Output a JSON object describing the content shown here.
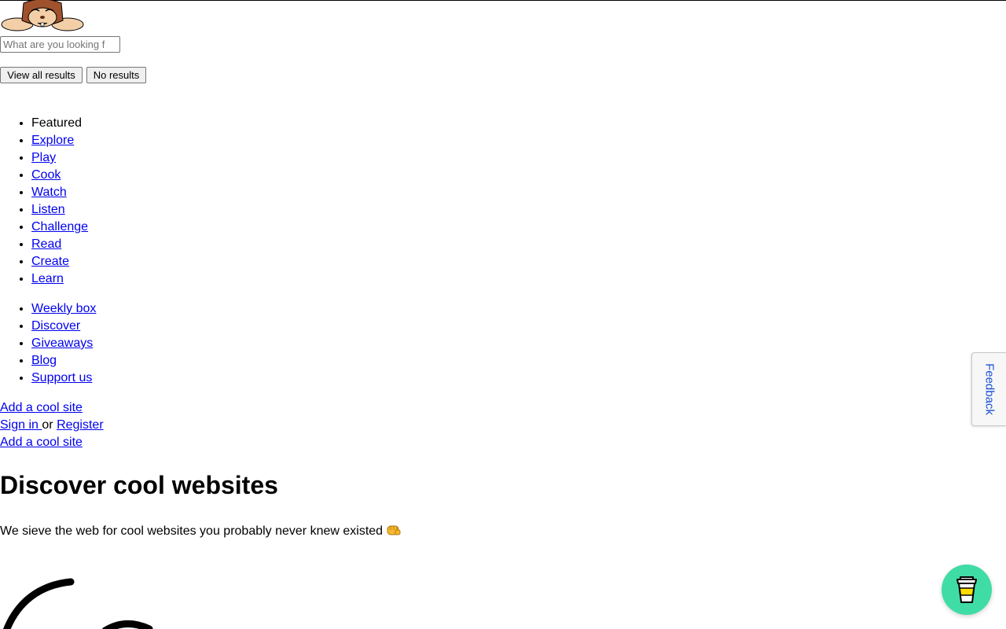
{
  "header": {
    "logo_icon": "chipmunk-mascot-logo"
  },
  "search": {
    "placeholder": "What are you looking f",
    "view_all_label": "View all results",
    "no_results_label": "No results"
  },
  "nav": {
    "main": [
      {
        "label": "Featured",
        "is_link": false
      },
      {
        "label": "Explore",
        "is_link": true
      },
      {
        "label": "Play",
        "is_link": true
      },
      {
        "label": "Cook",
        "is_link": true
      },
      {
        "label": "Watch",
        "is_link": true
      },
      {
        "label": "Listen",
        "is_link": true
      },
      {
        "label": "Challenge",
        "is_link": true
      },
      {
        "label": "Read",
        "is_link": true
      },
      {
        "label": "Create",
        "is_link": true
      },
      {
        "label": "Learn",
        "is_link": true
      }
    ],
    "secondary": [
      {
        "label": "Weekly box"
      },
      {
        "label": "Discover"
      },
      {
        "label": "Giveaways"
      },
      {
        "label": "Blog"
      },
      {
        "label": "Support us"
      }
    ]
  },
  "actions": {
    "add_site_label": "Add a cool site",
    "sign_in_label": "Sign in ",
    "or_text": "or",
    "register_label": "Register",
    "add_site_label_2": "Add a cool site"
  },
  "hero": {
    "title": "Discover cool websites",
    "tagline": "We sieve the web for cool websites you probably never knew existed",
    "tagline_icon": "fist-bump-emoji-icon"
  },
  "feedback": {
    "label": "Feedback"
  },
  "coffee": {
    "icon": "coffee-cup-icon",
    "color": "#40dca5"
  },
  "colors": {
    "link": "#0000ee",
    "feedback_text": "#1a4fd6"
  }
}
